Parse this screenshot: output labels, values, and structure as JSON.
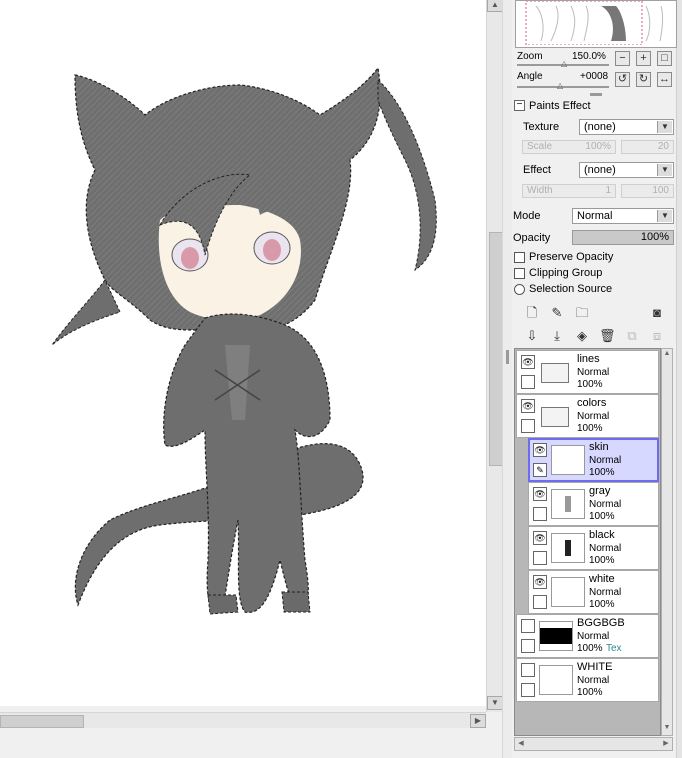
{
  "navigator": {
    "zoom_label": "Zoom",
    "zoom_value": "150.0%",
    "angle_label": "Angle",
    "angle_value": "+0008"
  },
  "paints_effect": {
    "header": "Paints Effect",
    "texture_label": "Texture",
    "texture_value": "(none)",
    "scale_label": "Scale",
    "scale_value": "100%",
    "scale_right": "20",
    "effect_label": "Effect",
    "effect_value": "(none)",
    "width_label": "Width",
    "width_value": "1",
    "width_right": "100"
  },
  "layer_props": {
    "mode_label": "Mode",
    "mode_value": "Normal",
    "opacity_label": "Opacity",
    "opacity_value": "100%",
    "preserve_opacity": "Preserve Opacity",
    "clipping_group": "Clipping Group",
    "selection_source": "Selection Source"
  },
  "layers": [
    {
      "name": "lines",
      "mode": "Normal",
      "opacity": "100%",
      "type": "folder"
    },
    {
      "name": "colors",
      "mode": "Normal",
      "opacity": "100%",
      "type": "folder"
    },
    {
      "name": "skin",
      "mode": "Normal",
      "opacity": "100%",
      "type": "layer",
      "selected": true
    },
    {
      "name": "gray",
      "mode": "Normal",
      "opacity": "100%",
      "type": "layer"
    },
    {
      "name": "black",
      "mode": "Normal",
      "opacity": "100%",
      "type": "layer"
    },
    {
      "name": "white",
      "mode": "Normal",
      "opacity": "100%",
      "type": "layer"
    },
    {
      "name": "BGGBGB",
      "mode": "Normal",
      "opacity": "100%",
      "extra": "Tex",
      "type": "layer"
    },
    {
      "name": "WHITE",
      "mode": "Normal",
      "opacity": "100%",
      "type": "layer"
    }
  ],
  "colors": {
    "selected_layer_bg": "#d6d8ff",
    "selected_layer_border": "#6b6cf0",
    "character_gray": "#6e6e6e",
    "tex_label": "#2e8b8b"
  }
}
